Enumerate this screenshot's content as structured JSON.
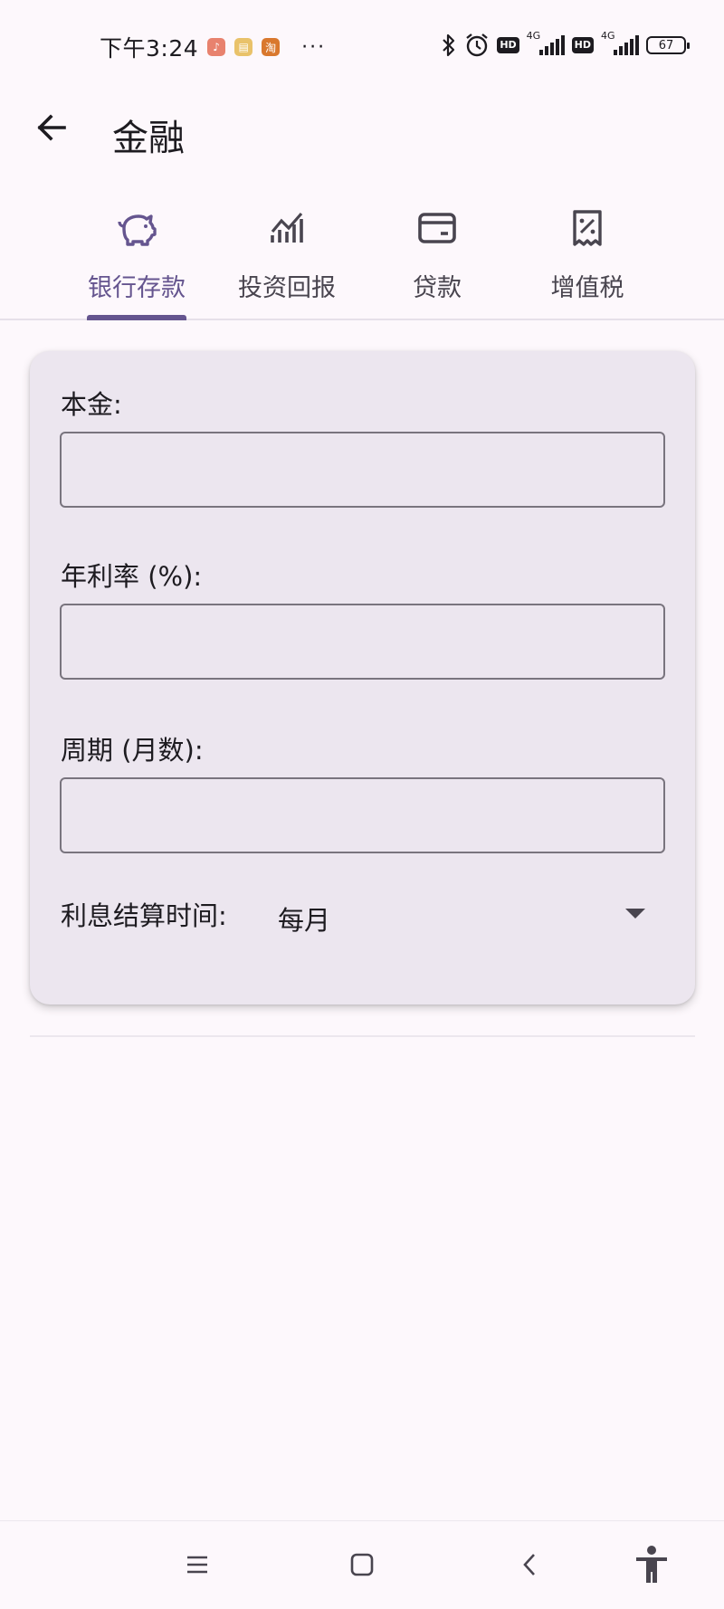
{
  "status_bar": {
    "time": "下午3:24",
    "dots": "···",
    "hd1": "HD",
    "net1": "4G",
    "hd2": "HD",
    "net2": "4G",
    "battery": "67"
  },
  "app_bar": {
    "title": "金融"
  },
  "tabs": [
    {
      "label": "银行存款",
      "icon": "piggy-bank-icon",
      "active": true
    },
    {
      "label": "投资回报",
      "icon": "chart-bars-icon",
      "active": false
    },
    {
      "label": "贷款",
      "icon": "wallet-icon",
      "active": false
    },
    {
      "label": "增值税",
      "icon": "tax-receipt-icon",
      "active": false
    }
  ],
  "form": {
    "principal_label": "本金:",
    "principal_value": "",
    "rate_label": "年利率 (%):",
    "rate_value": "",
    "period_label": "周期 (月数):",
    "period_value": "",
    "settlement_label": "利息结算时间:",
    "settlement_value": "每月"
  },
  "colors": {
    "accent": "#65558f",
    "background": "#fdf8fc",
    "card": "#ece6ef",
    "outline": "#79747e"
  }
}
